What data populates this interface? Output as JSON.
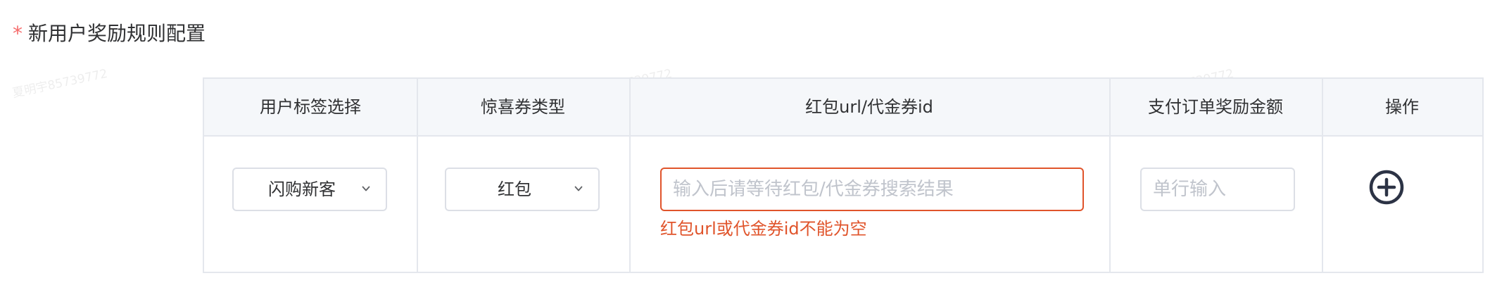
{
  "section": {
    "required_mark": "*",
    "title": "新用户奖励规则配置"
  },
  "watermark": {
    "text": "夏明宇85739772"
  },
  "table": {
    "headers": [
      "用户标签选择",
      "惊喜券类型",
      "红包url/代金券id",
      "支付订单奖励金额",
      "操作"
    ],
    "row": {
      "user_tag": "闪购新客",
      "coupon_type": "红包",
      "url_placeholder": "输入后请等待红包/代金券搜索结果",
      "url_value": "",
      "url_error": "红包url或代金券id不能为空",
      "amount_placeholder": "单行输入",
      "amount_value": ""
    }
  },
  "icons": {
    "select_arrow": "chevron-down-icon",
    "add": "plus-circle-icon"
  },
  "colors": {
    "error": "#e0542b",
    "required": "#f56c6c",
    "header_bg": "#f5f7fa",
    "border": "#e4e7ed",
    "add_icon": "#2c3345"
  }
}
